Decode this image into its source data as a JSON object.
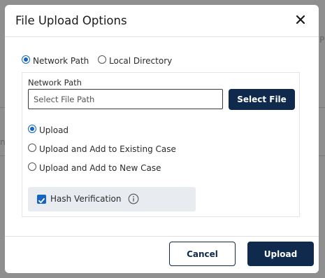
{
  "modal": {
    "title": "File Upload Options",
    "close_icon": "close-icon"
  },
  "source": {
    "options": [
      {
        "label": "Network Path",
        "selected": true
      },
      {
        "label": "Local Directory",
        "selected": false
      }
    ]
  },
  "network_path": {
    "label": "Network Path",
    "placeholder": "Select File Path",
    "value": "",
    "select_button": "Select File"
  },
  "upload_mode": {
    "options": [
      {
        "label": "Upload",
        "selected": true
      },
      {
        "label": "Upload and Add to Existing Case",
        "selected": false
      },
      {
        "label": "Upload and Add to New Case",
        "selected": false
      }
    ]
  },
  "hash": {
    "label": "Hash Verification",
    "checked": true,
    "info_icon": "info-icon"
  },
  "footer": {
    "cancel_label": "Cancel",
    "upload_label": "Upload"
  },
  "colors": {
    "primary": "#0f2a4c",
    "accent": "#1565c0"
  },
  "background": {
    "text_p": "P",
    "text_n": "n"
  }
}
